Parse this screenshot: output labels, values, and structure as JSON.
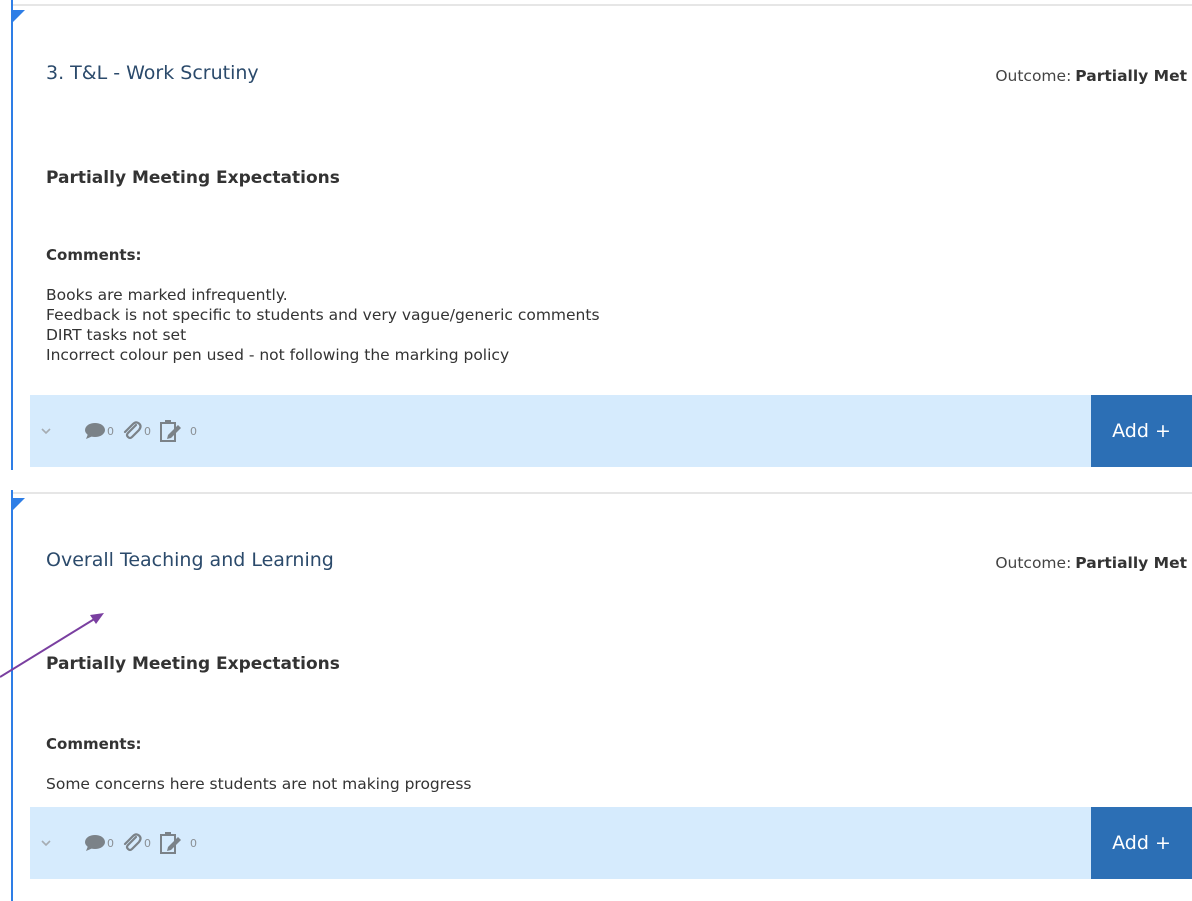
{
  "cards": [
    {
      "title": "3. T&L - Work Scrutiny",
      "outcome_label": "Outcome:",
      "outcome_value": "Partially Met",
      "expectation": "Partially Meeting Expectations",
      "comments_label": "Comments:",
      "comments": [
        "Books are marked infrequently.",
        "Feedback is not specific to students and very vague/generic comments",
        "DIRT tasks not set",
        "Incorrect colour pen used - not following the marking policy"
      ],
      "comment_count": "0",
      "attachment_count": "0",
      "task_count": "0",
      "add_label": "Add +"
    },
    {
      "title": "Overall Teaching and Learning",
      "outcome_label": "Outcome:",
      "outcome_value": "Partially Met",
      "expectation": "Partially Meeting Expectations",
      "comments_label": "Comments:",
      "comments": [
        "Some concerns here students are not making progress"
      ],
      "comment_count": "0",
      "attachment_count": "0",
      "task_count": "0",
      "add_label": "Add +"
    }
  ],
  "colors": {
    "accent": "#2e7ee6",
    "bar_bg": "#d6ebfd",
    "add_button": "#2c6fb5",
    "annotation_arrow": "#7a3fa0"
  },
  "icons": [
    "chevron-down-icon",
    "comment-icon",
    "paperclip-icon",
    "edit-task-icon"
  ]
}
